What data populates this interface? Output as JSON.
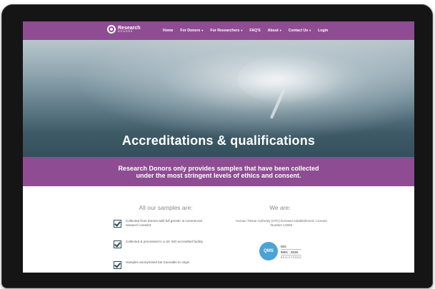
{
  "nav": {
    "logo_main": "Research",
    "logo_sub": "DONORS",
    "items": [
      {
        "label": "Home",
        "dropdown": false
      },
      {
        "label": "For Donors",
        "dropdown": true
      },
      {
        "label": "For Researchers",
        "dropdown": true
      },
      {
        "label": "FAQ'S",
        "dropdown": false
      },
      {
        "label": "About",
        "dropdown": true
      },
      {
        "label": "Contact Us",
        "dropdown": true
      },
      {
        "label": "Login",
        "dropdown": false
      }
    ],
    "caret": "▾"
  },
  "hero": {
    "title": "Accreditations & qualifications"
  },
  "band": {
    "line1": "Research Donors only provides samples that have been collected",
    "line2": "under the most stringent levels of ethics and consent."
  },
  "samples": {
    "heading": "All our samples are:",
    "items": [
      "Collected from donors with full genetic & commercial research consent",
      "Collected & processed in a UK ISO accredited facility",
      "Samples anonymised but traceable to origin"
    ]
  },
  "we_are": {
    "heading": "We are:",
    "hta_text": "Human Tissue Authority (HTA) licensed establishment: License Number 12693",
    "qms_label": "QMS",
    "iso_label": "ISO",
    "iso_number": "9001 : 2015",
    "iso_registered": "REGISTERED"
  },
  "colors": {
    "brand_purple": "#8e4d93",
    "hero_dark": "#35505c",
    "checkbox": "#2b4a5a",
    "qms_blue": "#4aa3d6"
  }
}
